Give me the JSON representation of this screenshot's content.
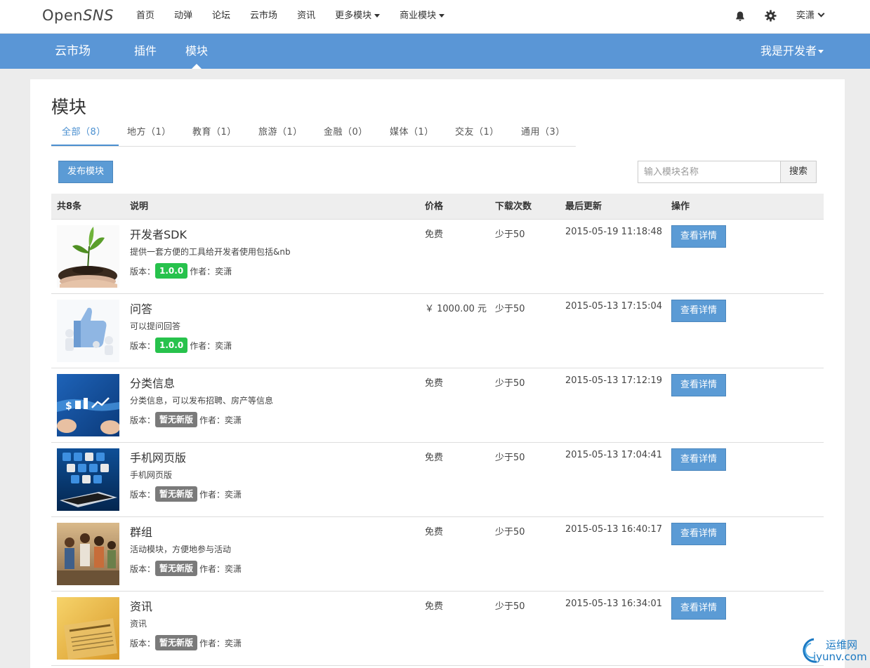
{
  "topnav": {
    "logo_open": "Open",
    "logo_sns": "SNS",
    "links": [
      "首页",
      "动弹",
      "论坛",
      "云市场",
      "资讯",
      "更多模块",
      "商业模块"
    ],
    "user": "奕潇"
  },
  "subnav": {
    "brand": "云市场",
    "items": [
      "插件",
      "模块"
    ],
    "active": "模块",
    "developer": "我是开发者"
  },
  "page": {
    "title": "模块",
    "tabs": [
      "全部（8）",
      "地方（1）",
      "教育（1）",
      "旅游（1）",
      "金融（0）",
      "媒体（1）",
      "交友（1）",
      "通用（3）"
    ],
    "active_tab": "全部（8）",
    "publish_label": "发布模块",
    "search_placeholder": "输入模块名称",
    "search_label": "搜索"
  },
  "table": {
    "headers": [
      "共8条",
      "说明",
      "价格",
      "下载次数",
      "最后更新",
      "操作"
    ],
    "rows": [
      {
        "title": "开发者SDK",
        "desc": "提供一套方便的工具给开发者使用包括&nb",
        "version_label": "版本：",
        "version": "1.0.0",
        "version_status": "green",
        "author": "作者：奕潇",
        "price": "免费",
        "downloads": "少于50",
        "updated": "2015-05-19 11:18:48",
        "action": "查看详情",
        "thumb": "sprout"
      },
      {
        "title": "问答",
        "desc": "可以提问回答",
        "version_label": "版本：",
        "version": "1.0.0",
        "version_status": "green",
        "author": "作者：奕潇",
        "price": "￥ 1000.00 元",
        "downloads": "少于50",
        "updated": "2015-05-13 17:15:04",
        "action": "查看详情",
        "thumb": "thumbs-up"
      },
      {
        "title": "分类信息",
        "desc": "分类信息，可以发布招聘、房产等信息",
        "version_label": "版本：",
        "version": "暂无新版",
        "version_status": "gray",
        "author": "作者：奕潇",
        "price": "免费",
        "downloads": "少于50",
        "updated": "2015-05-13 17:12:19",
        "action": "查看详情",
        "thumb": "business"
      },
      {
        "title": "手机网页版",
        "desc": "手机网页版",
        "version_label": "版本：",
        "version": "暂无新版",
        "version_status": "gray",
        "author": "作者：奕潇",
        "price": "免费",
        "downloads": "少于50",
        "updated": "2015-05-13 17:04:41",
        "action": "查看详情",
        "thumb": "mobile-apps"
      },
      {
        "title": "群组",
        "desc": "活动模块，方便地参与活动",
        "version_label": "版本：",
        "version": "暂无新版",
        "version_status": "gray",
        "author": "作者：奕潇",
        "price": "免费",
        "downloads": "少于50",
        "updated": "2015-05-13 16:40:17",
        "action": "查看详情",
        "thumb": "group-photo"
      },
      {
        "title": "资讯",
        "desc": "资讯",
        "version_label": "版本：",
        "version": "暂无新版",
        "version_status": "gray",
        "author": "作者：奕潇",
        "price": "免费",
        "downloads": "少于50",
        "updated": "2015-05-13 16:34:01",
        "action": "查看详情",
        "thumb": "newspaper"
      }
    ]
  },
  "watermark": {
    "line1": "运维网",
    "line2": "iyunv.com"
  },
  "colors": {
    "primary": "#5a96d6",
    "button": "#5b9bd5",
    "active_tab": "#4a8fd0",
    "version_green": "#27c24c",
    "version_gray": "#7a7a7a"
  }
}
